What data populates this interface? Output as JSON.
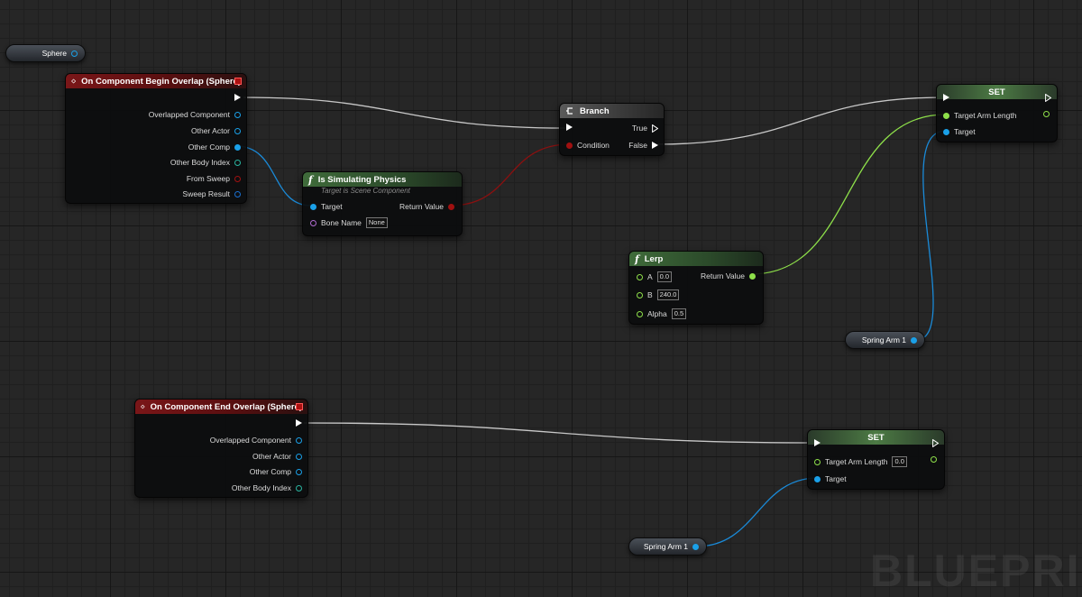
{
  "colors": {
    "exec": "#ffffff",
    "object": "#1aa0e8",
    "bool": "#a01010",
    "float": "#8ee04a",
    "struct": "#2ab5a0",
    "name": "#b06ad0",
    "hit": "#1a6fd0"
  },
  "variables": {
    "sphere": "Sphere",
    "spring_arm_a": "Spring Arm 1",
    "spring_arm_b": "Spring Arm 1"
  },
  "begin_overlap": {
    "title": "On Component Begin Overlap (Sphere)",
    "pins": [
      "Overlapped Component",
      "Other Actor",
      "Other Comp",
      "Other Body Index",
      "From Sweep",
      "Sweep Result"
    ]
  },
  "is_sim": {
    "title": "Is Simulating Physics",
    "subtitle": "Target is Scene Component",
    "target": "Target",
    "bone_name": "Bone Name",
    "bone_value": "None",
    "return_value": "Return Value"
  },
  "branch": {
    "title": "Branch",
    "condition": "Condition",
    "true_label": "True",
    "false_label": "False"
  },
  "set_top": {
    "title": "SET",
    "target_arm": "Target Arm Length",
    "target": "Target"
  },
  "lerp": {
    "title": "Lerp",
    "a_label": "A",
    "a_value": "0.0",
    "b_label": "B",
    "b_value": "240.0",
    "alpha_label": "Alpha",
    "alpha_value": "0.5",
    "return_value": "Return Value"
  },
  "end_overlap": {
    "title": "On Component End Overlap (Sphere)",
    "pins": [
      "Overlapped Component",
      "Other Actor",
      "Other Comp",
      "Other Body Index"
    ]
  },
  "set_bottom": {
    "title": "SET",
    "target_arm": "Target Arm Length",
    "target_arm_value": "0.0",
    "target": "Target"
  },
  "watermark": "BLUEPRI"
}
